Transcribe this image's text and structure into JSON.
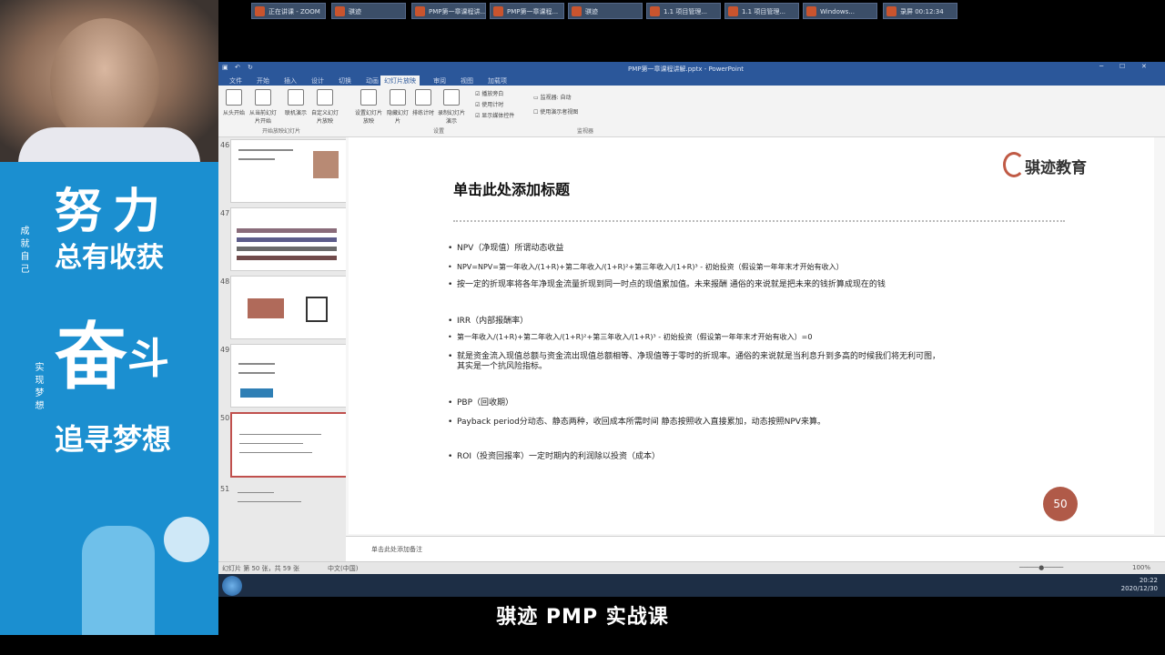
{
  "banner": {
    "chars": [
      "努",
      "力",
      "总有收获",
      "奋",
      "斗",
      "追寻梦想"
    ],
    "side_text": [
      "成就自己",
      "实现梦想"
    ]
  },
  "app": {
    "title": "PMP第一章课程讲解.pptx - PowerPoint",
    "tabs": [
      "文件",
      "开始",
      "插入",
      "设计",
      "切换",
      "动画",
      "幻灯片放映",
      "审阅",
      "视图",
      "加载项"
    ],
    "active_tab": "幻灯片放映",
    "ribbon": {
      "buttons": [
        "从头开始",
        "从当前幻灯片开始",
        "联机演示",
        "自定义幻灯片放映",
        "设置幻灯片放映",
        "隐藏幻灯片",
        "排练计时",
        "录制幻灯片演示"
      ],
      "checks": [
        "播放旁白",
        "使用计时",
        "显示媒体控件"
      ],
      "monitor_checks": [
        "监视器: 自动",
        "使用演示者视图"
      ],
      "groups": [
        "开始放映幻灯片",
        "设置",
        "监视器"
      ]
    },
    "thumbnails": [
      {
        "num": "46"
      },
      {
        "num": "47"
      },
      {
        "num": "48"
      },
      {
        "num": "49"
      },
      {
        "num": "50",
        "selected": true
      },
      {
        "num": "51"
      }
    ],
    "slide": {
      "logo": "骐迹教育",
      "title": "单击此处添加标题",
      "bullets": [
        "NPV（净现值）所谓动态收益",
        "NPV=NPV=第一年收入/(1+R)+第二年收入/(1+R)²+第三年收入/(1+R)³ - 初始投资（假设第一年年末才开始有收入）",
        "按一定的折现率将各年净现金流量折现到同一时点的现值累加值。未来报酬 通俗的来说就是把未来的钱折算成现在的钱",
        "IRR（内部报酬率）",
        "第一年收入/(1+R)+第二年收入/(1+R)²+第三年收入/(1+R)³ - 初始投资（假设第一年年末才开始有收入）=0",
        "就是资金流入现值总额与资金流出现值总额相等、净现值等于零时的折现率。通俗的来说就是当利息升到多高的时候我们将无利可图，",
        "其实是一个抗风险指标。",
        "PBP（回收期）",
        "Payback period分动态、静态两种，收回成本所需时间 静态按照收入直接累加，动态按照NPV来算。",
        "ROI（投资回报率）一定时期内的利润除以投资（成本）"
      ],
      "number": "50"
    },
    "notes_placeholder": "单击此处添加备注",
    "status": {
      "left": "幻灯片 第 50 张，共 59 张",
      "language": "中文(中国)",
      "zoom": "100%"
    }
  },
  "taskbar": {
    "items": [
      "正在讲课 - ZOOM",
      "骐迹",
      "PMP第一章课程讲...",
      "PMP第一章课程...",
      "骐迹",
      "1.1 项目管理...",
      "1.1 项目管理...",
      "Windows...",
      "录屏 00:12:34"
    ],
    "time": "20:22",
    "date": "2020/12/30"
  },
  "subtitle": "骐迹 PMP 实战课",
  "colors": {
    "accent": "#2b579a",
    "brand": "#b05a48",
    "banner": "#1b8fd0"
  }
}
